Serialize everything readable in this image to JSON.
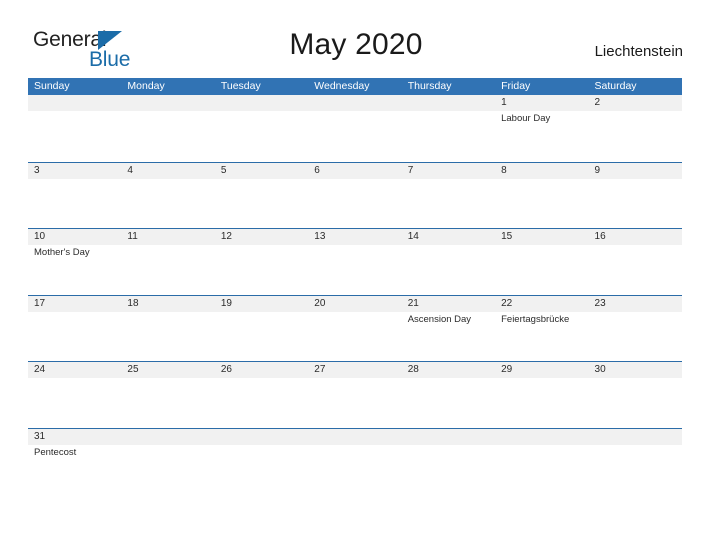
{
  "logo": {
    "word_dark": "General",
    "word_blue": "Blue",
    "triangle_icon": "triangle-icon",
    "accent_color": "#1b6ca8"
  },
  "header": {
    "title": "May 2020",
    "country": "Liechtenstein"
  },
  "colors": {
    "header_blue": "#3173b4",
    "row_divider": "#2b6ca8",
    "band_gray": "#f1f1f1"
  },
  "calendar": {
    "weekdays": [
      "Sunday",
      "Monday",
      "Tuesday",
      "Wednesday",
      "Thursday",
      "Friday",
      "Saturday"
    ],
    "weeks": [
      [
        {
          "day": "",
          "event": ""
        },
        {
          "day": "",
          "event": ""
        },
        {
          "day": "",
          "event": ""
        },
        {
          "day": "",
          "event": ""
        },
        {
          "day": "",
          "event": ""
        },
        {
          "day": "1",
          "event": "Labour Day"
        },
        {
          "day": "2",
          "event": ""
        }
      ],
      [
        {
          "day": "3",
          "event": ""
        },
        {
          "day": "4",
          "event": ""
        },
        {
          "day": "5",
          "event": ""
        },
        {
          "day": "6",
          "event": ""
        },
        {
          "day": "7",
          "event": ""
        },
        {
          "day": "8",
          "event": ""
        },
        {
          "day": "9",
          "event": ""
        }
      ],
      [
        {
          "day": "10",
          "event": "Mother's Day"
        },
        {
          "day": "11",
          "event": ""
        },
        {
          "day": "12",
          "event": ""
        },
        {
          "day": "13",
          "event": ""
        },
        {
          "day": "14",
          "event": ""
        },
        {
          "day": "15",
          "event": ""
        },
        {
          "day": "16",
          "event": ""
        }
      ],
      [
        {
          "day": "17",
          "event": ""
        },
        {
          "day": "18",
          "event": ""
        },
        {
          "day": "19",
          "event": ""
        },
        {
          "day": "20",
          "event": ""
        },
        {
          "day": "21",
          "event": "Ascension Day"
        },
        {
          "day": "22",
          "event": "Feiertagsbrücke"
        },
        {
          "day": "23",
          "event": ""
        }
      ],
      [
        {
          "day": "24",
          "event": ""
        },
        {
          "day": "25",
          "event": ""
        },
        {
          "day": "26",
          "event": ""
        },
        {
          "day": "27",
          "event": ""
        },
        {
          "day": "28",
          "event": ""
        },
        {
          "day": "29",
          "event": ""
        },
        {
          "day": "30",
          "event": ""
        }
      ],
      [
        {
          "day": "31",
          "event": "Pentecost"
        },
        {
          "day": "",
          "event": ""
        },
        {
          "day": "",
          "event": ""
        },
        {
          "day": "",
          "event": ""
        },
        {
          "day": "",
          "event": ""
        },
        {
          "day": "",
          "event": ""
        },
        {
          "day": "",
          "event": ""
        }
      ]
    ]
  }
}
